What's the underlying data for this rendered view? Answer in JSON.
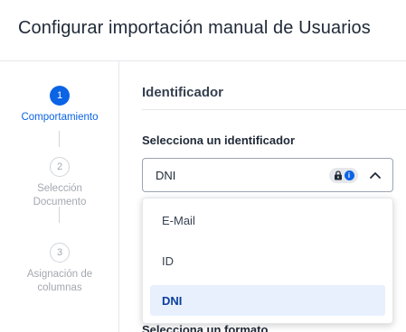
{
  "header": {
    "title": "Configurar importación manual de Usuarios"
  },
  "stepper": {
    "steps": [
      {
        "number": "1",
        "label_line1": "Comportamiento",
        "label_line2": "",
        "state": "active"
      },
      {
        "number": "2",
        "label_line1": "Selección",
        "label_line2": "Documento",
        "state": "inactive"
      },
      {
        "number": "3",
        "label_line1": "Asignación de",
        "label_line2": "columnas",
        "state": "inactive"
      }
    ]
  },
  "content": {
    "section_title": "Identificador",
    "field_label": "Selecciona un identificador",
    "select": {
      "value": "DNI",
      "badge_icons": [
        "lock-icon",
        "info-icon"
      ],
      "expanded": true
    },
    "options": [
      {
        "label": "E-Mail",
        "selected": false
      },
      {
        "label": "ID",
        "selected": false
      },
      {
        "label": "DNI",
        "selected": true
      }
    ],
    "next_field_label": "Selecciona un formato"
  },
  "colors": {
    "accent": "#0b63e5",
    "selected_bg": "#e8f0fd",
    "muted": "#a3a8b0"
  }
}
